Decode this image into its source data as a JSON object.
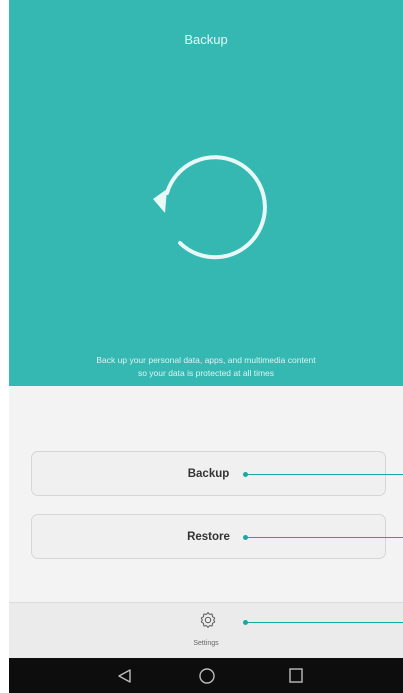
{
  "header": {
    "title": "Backup"
  },
  "hero": {
    "description_line1": "Back up your personal data, apps, and multimedia content",
    "description_line2": "so your data is protected at all times"
  },
  "actions": {
    "backup_label": "Backup",
    "restore_label": "Restore"
  },
  "bottom_bar": {
    "settings_label": "Settings"
  },
  "colors": {
    "accent": "#35b8b2",
    "callout": "#1aa7a4",
    "navbar": "#0d0d0d"
  }
}
